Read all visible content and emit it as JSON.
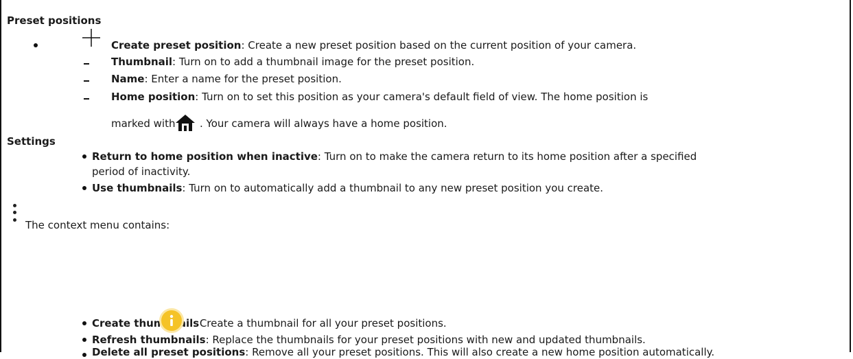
{
  "section_preset": {
    "heading": "Preset positions"
  },
  "create_preset": {
    "icon": "plus-icon",
    "label": "Create preset position",
    "desc": ": Create a new preset position based on the current position of your camera.",
    "sub_items": [
      {
        "label": "Thumbnail",
        "desc": ": Turn on to add a thumbnail image for the preset position."
      },
      {
        "label": "Name",
        "desc": ": Enter a name for the preset position."
      },
      {
        "label": "Home position",
        "desc": ": Turn on to set this position as your camera's default field of view. The home position is"
      }
    ],
    "home_cont_before": "marked with",
    "home_icon": "home-icon",
    "home_cont_after": ". Your camera will always have a home position."
  },
  "settings": {
    "heading": "Settings",
    "items": [
      {
        "label": "Return to home position when inactive",
        "desc": ": Turn on to make the camera return to its home position after a specified",
        "cont": "period of inactivity."
      },
      {
        "label": "Use thumbnails",
        "desc": ": Turn on to automatically add a thumbnail to any new preset position you create."
      }
    ]
  },
  "context_menu": {
    "icon": "more-vertical-icon",
    "intro": "The context menu contains:",
    "info_icon": "info-icon",
    "info_color": "#f5c327",
    "items": [
      {
        "label": "Create thumbnails",
        "desc": ": Create a thumbnail for all your preset positions."
      },
      {
        "label": "Refresh thumbnails",
        "desc": ": Replace the thumbnails for your preset positions with new and updated thumbnails."
      },
      {
        "label": "Delete all preset positions",
        "desc": ": Remove all your preset positions. This will also create a new home position automatically."
      }
    ]
  }
}
